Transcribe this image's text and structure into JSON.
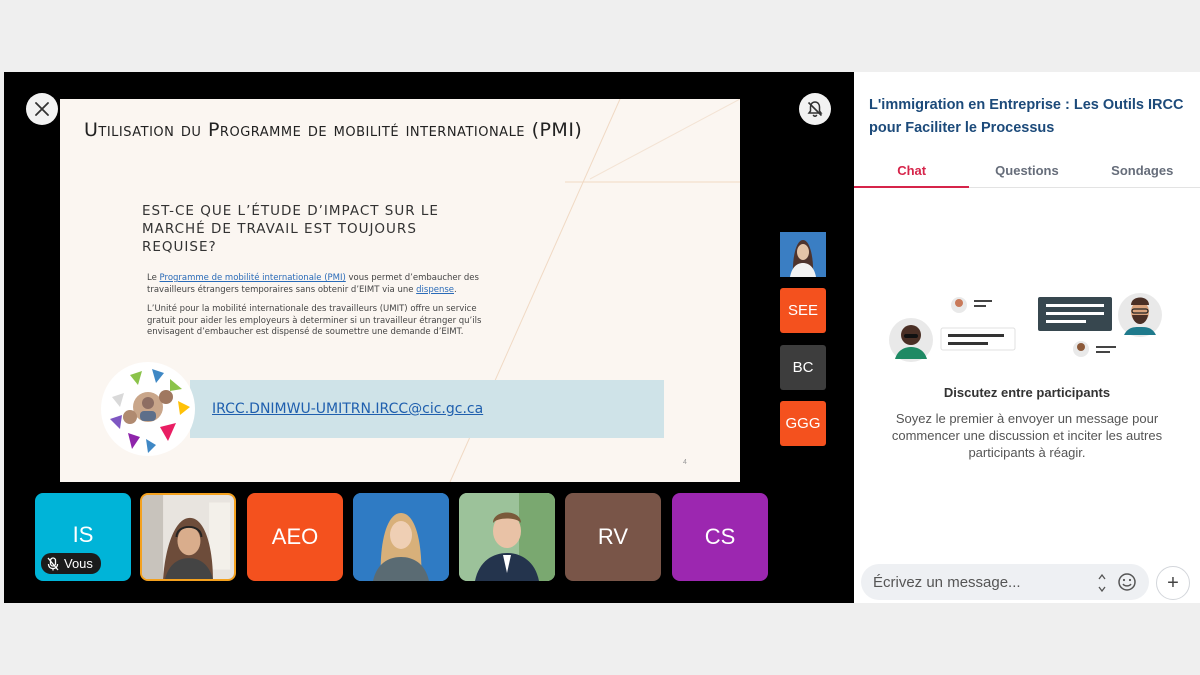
{
  "stage": {
    "slide": {
      "title": "Utilisation du Programme de mobilité internationale (PMI)",
      "question": "Est-ce que l’étude d’impact sur le marché de travail est toujours requise?",
      "para1": {
        "prefix": "Le ",
        "link1": "Programme de mobilité internationale (PMI)",
        "middle": " vous permet d’embaucher des travailleurs étrangers temporaires sans obtenir d’EIMT via une ",
        "link2": "dispense",
        "suffix": "."
      },
      "para2": "L’Unité pour la mobilité internationale des travailleurs (UMIT) offre un service gratuit pour aider les employeurs à determiner si un travailleur étranger qu’ils envisagent d’embaucher est dispensé de soumettre une demande d’EIMT.",
      "email": "IRCC.DNIMWU-UMITRN.IRCC@cic.gc.ca",
      "page_number": "4"
    },
    "side_tiles": [
      {
        "label": "",
        "color": "#2f6db0",
        "icon": "person-photo-woman"
      },
      {
        "label": "SEE",
        "color": "#f4511e"
      },
      {
        "label": "BC",
        "color": "#3d3d3d"
      },
      {
        "label": "GGG",
        "color": "#f4511e"
      }
    ],
    "bottom_tiles": [
      {
        "label": "IS",
        "color": "#00b4d8",
        "badge": "Vous",
        "icon": "mic-off-icon"
      },
      {
        "label": "",
        "color": "#8c8c8c",
        "icon": "person-photo-woman-headset"
      },
      {
        "label": "AEO",
        "color": "#f4511e"
      },
      {
        "label": "",
        "color": "#2f7bc4",
        "icon": "person-photo-woman-blonde"
      },
      {
        "label": "",
        "color": "#6a9c6a",
        "icon": "person-photo-man"
      },
      {
        "label": "RV",
        "color": "#795548"
      },
      {
        "label": "CS",
        "color": "#9c27b0"
      }
    ],
    "colors": {
      "accent": "#d6244a",
      "title": "#1c4a7a"
    }
  },
  "panel": {
    "event_title": "L'immigration en Entreprise : Les Outils IRCC pour Faciliter le Processus",
    "tabs": [
      {
        "label": "Chat",
        "active": true
      },
      {
        "label": "Questions",
        "active": false
      },
      {
        "label": "Sondages",
        "active": false
      }
    ],
    "empty_title": "Discutez entre participants",
    "empty_desc": "Soyez le premier à envoyer un message pour commencer une discussion et inciter les autres participants à réagir.",
    "composer": {
      "placeholder": "Écrivez un message..."
    },
    "add_label": "+"
  }
}
